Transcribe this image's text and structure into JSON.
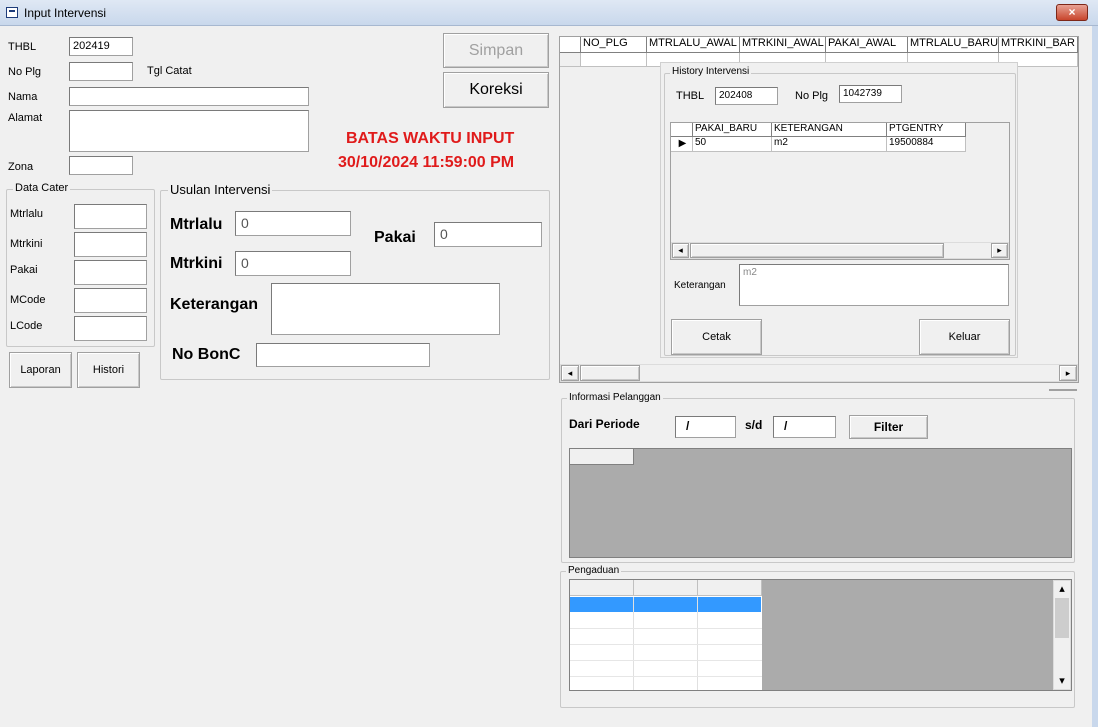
{
  "window": {
    "title": "Input Intervensi",
    "close_glyph": "×"
  },
  "left": {
    "thbl_label": "THBL",
    "thbl_value": "202419",
    "noplg_label": "No Plg",
    "noplg_value": "",
    "tglcatat_label": "Tgl Catat",
    "nama_label": "Nama",
    "nama_value": "",
    "alamat_label": "Alamat",
    "alamat_value": "",
    "zona_label": "Zona",
    "zona_value": ""
  },
  "buttons": {
    "simpan": "Simpan",
    "koreksi": "Koreksi",
    "laporan": "Laporan",
    "histori": "Histori"
  },
  "deadline": {
    "line1": "BATAS WAKTU INPUT",
    "line2": "30/10/2024 11:59:00 PM"
  },
  "data_cater": {
    "title": "Data Cater",
    "mtrlalu": "Mtrlalu",
    "mtrkini": "Mtrkini",
    "pakai": "Pakai",
    "mcode": "MCode",
    "lcode": "LCode"
  },
  "usulan": {
    "title": "Usulan Intervensi",
    "mtrlalu_label": "Mtrlalu",
    "mtrlalu_value": "0",
    "mtrkini_label": "Mtrkini",
    "mtrkini_value": "0",
    "pakai_label": "Pakai",
    "pakai_value": "0",
    "keterangan_label": "Keterangan",
    "keterangan_value": "",
    "nobonc_label": "No BonC",
    "nobonc_value": ""
  },
  "main_grid": {
    "columns": [
      "NO_PLG",
      "MTRLALU_AWAL",
      "MTRKINI_AWAL",
      "PAKAI_AWAL",
      "MTRLALU_BARU",
      "MTRKINI_BAR"
    ]
  },
  "history": {
    "title": "History Intervensi",
    "thbl_label": "THBL",
    "thbl_value": "202408",
    "noplg_label": "No Plg",
    "noplg_value": "1042739",
    "columns": [
      "PAKAI_BARU",
      "KETERANGAN",
      "PTGENTRY"
    ],
    "rows": [
      [
        "50",
        "m2",
        "19500884"
      ]
    ],
    "keterangan_label": "Keterangan",
    "keterangan_value": "m2",
    "cetak": "Cetak",
    "keluar": "Keluar"
  },
  "info": {
    "title": "Informasi Pelanggan",
    "dari_periode": "Dari Periode",
    "from_value": "/",
    "sd": "s/d",
    "to_value": "/",
    "filter": "Filter"
  },
  "pengaduan": {
    "title": "Pengaduan"
  },
  "icons": {
    "row_pointer": "▶",
    "left": "◂",
    "right": "▸",
    "up": "▴",
    "down": "▾"
  }
}
